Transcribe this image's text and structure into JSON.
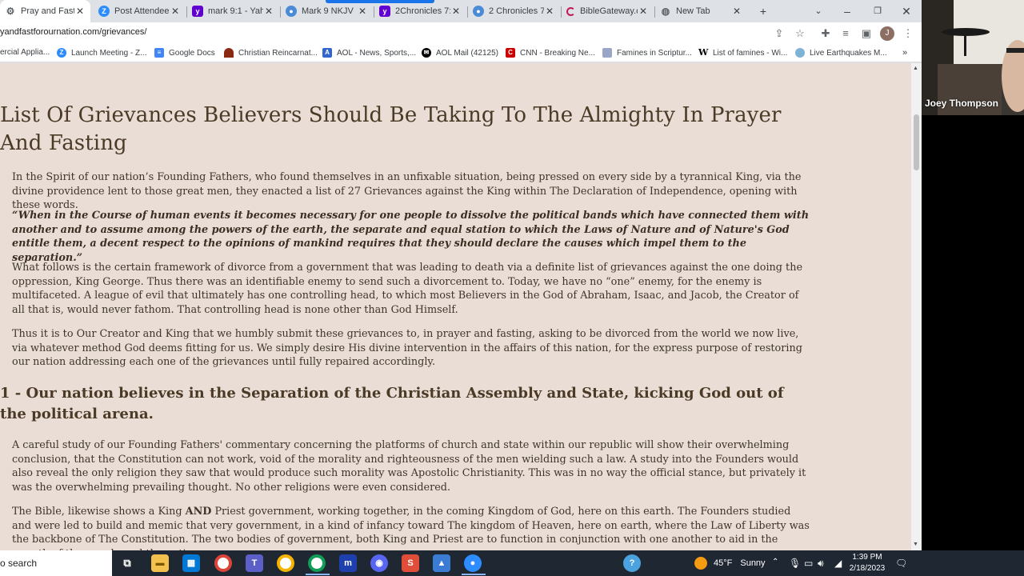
{
  "tabs": [
    {
      "title": "Pray and Fast f",
      "favicon": "gear-icon",
      "active": true
    },
    {
      "title": "Post Attendee",
      "favicon": "zoom-icon"
    },
    {
      "title": "mark 9:1 - Yah",
      "favicon": "yahoo-icon"
    },
    {
      "title": "Mark 9 NKJV",
      "favicon": "biblegateway-icon"
    },
    {
      "title": "2Chronicles 7:",
      "favicon": "yahoo-icon"
    },
    {
      "title": "2 Chronicles 7:",
      "favicon": "biblegateway-icon"
    },
    {
      "title": "BibleGateway.c",
      "favicon": "loading-icon"
    },
    {
      "title": "New Tab",
      "favicon": "globe-icon"
    }
  ],
  "address": {
    "url": "yandfastforournation.com/grievances/"
  },
  "bookmarks": [
    {
      "label": "ercial Applia...",
      "icon": "page-icon"
    },
    {
      "label": "Launch Meeting - Z...",
      "icon": "zoom-icon"
    },
    {
      "label": "Google Docs",
      "icon": "docs-icon"
    },
    {
      "label": "Christian Reincarnat...",
      "icon": "page-icon"
    },
    {
      "label": "AOL - News, Sports,...",
      "icon": "aol-icon"
    },
    {
      "label": "AOL Mail (42125)",
      "icon": "aol-mail-icon"
    },
    {
      "label": "CNN - Breaking Ne...",
      "icon": "cnn-icon"
    },
    {
      "label": "Famines in Scriptur...",
      "icon": "page-icon"
    },
    {
      "label": "List of famines - Wi...",
      "icon": "wikipedia-icon"
    },
    {
      "label": "Live Earthquakes M...",
      "icon": "page-icon"
    }
  ],
  "article": {
    "title": "List Of Grievances Believers Should Be Taking To The Almighty In Prayer And Fasting",
    "p1": "In the Spirit of our nation’s Founding Fathers, who found themselves in an unfixable situation, being pressed on every side by a tyrannical King, via the divine providence lent to those great men, they enacted a list of 27 Grievances against the King within The Declaration of Independence, opening with these words.",
    "quote": "“When in the Course of human events it becomes necessary for one people to dissolve the political bands which have connected them with another and to assume among the powers of the earth, the separate and equal station to which the Laws of Nature and of Nature's God entitle them, a decent respect to the opinions of mankind requires that they should declare the causes which impel them to the separation.”",
    "p2": "What follows is the certain framework of divorce from a government that was leading to death via a definite list of grievances against the one doing the oppression, King George. Thus there was an identifiable enemy to send such a divorcement to. Today, we have no “one” enemy, for the enemy is multifaceted. A league of evil that ultimately has one controlling head, to which most Believers in the God of Abraham, Isaac, and Jacob, the Creator of all that is, would never fathom. That controlling head is none other than God Himself.",
    "p3": "Thus it is to Our Creator and King that we humbly submit these grievances to, in prayer and fasting, asking to be divorced from the world we now live, via whatever method God deems fitting for us. We simply desire His divine intervention in the affairs of this nation, for the express purpose of restoring our nation addressing each one of the grievances until fully repaired accordingly.",
    "h2": "1 - Our nation believes in the Separation of the Christian Assembly and State, kicking God out of the political arena.",
    "p4": "A careful study of our Founding Fathers' commentary concerning the platforms of church and state within our republic will show their overwhelming conclusion, that the Constitution can not work, void of the morality and righteousness of the men wielding such a law. A study into the Founders would also reveal the only religion they saw that would produce such morality was Apostolic Christianity. This was in no way the official stance, but privately it was the overwhelming prevailing thought. No other religions were even considered.",
    "p5_pre": "The Bible, likewise shows a King ",
    "p5_bold": "AND",
    "p5_post": " Priest government, working together, in the coming Kingdom of God, here on this earth. The Founders studied and were led to build and memic that very government, in a kind of infancy toward The kingdom of Heaven, here on earth, where the Law of Liberty was the backbone of The Constitution. The two bodies of government, both King and Priest are to function in conjunction with one another to aid in the growth of the people and the nation."
  },
  "zoom": {
    "participant_name": "Joey Thompson"
  },
  "taskbar": {
    "search_placeholder": "o search",
    "weather_temp": "45°F",
    "weather_text": "Sunny",
    "time": "1:39 PM",
    "date": "2/18/2023"
  },
  "colors": {
    "page_bg": "#e9ddd5",
    "text": "#3e3528",
    "taskbar": "#1f2733",
    "tab_indicator": "#1a73e8"
  }
}
